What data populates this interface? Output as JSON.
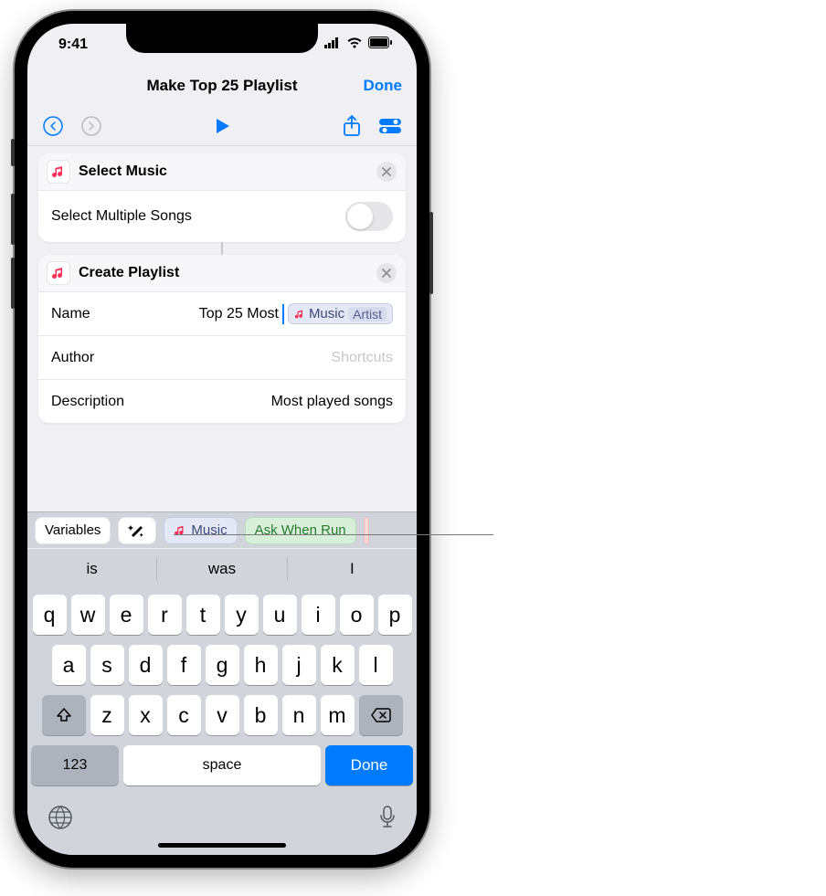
{
  "statusbar": {
    "time": "9:41"
  },
  "navbar": {
    "title": "Make Top 25 Playlist",
    "done": "Done"
  },
  "toolbar": {
    "undo_enabled": true,
    "redo_enabled": false
  },
  "action1": {
    "title": "Select Music",
    "row1_label": "Select Multiple Songs"
  },
  "action2": {
    "title": "Create Playlist",
    "name_label": "Name",
    "name_text": "Top 25 Most ",
    "name_token": "Music",
    "name_token_sub": "Artist",
    "author_label": "Author",
    "author_placeholder": "Shortcuts",
    "desc_label": "Description",
    "desc_value": "Most played songs"
  },
  "varbar": {
    "variables": "Variables",
    "music": "Music",
    "ask": "Ask When Run"
  },
  "suggestions": [
    "is",
    "was",
    "I"
  ],
  "keys_r1": [
    "q",
    "w",
    "e",
    "r",
    "t",
    "y",
    "u",
    "i",
    "o",
    "p"
  ],
  "keys_r2": [
    "a",
    "s",
    "d",
    "f",
    "g",
    "h",
    "j",
    "k",
    "l"
  ],
  "keys_r3": [
    "z",
    "x",
    "c",
    "v",
    "b",
    "n",
    "m"
  ],
  "key_num": "123",
  "key_space": "space",
  "key_done": "Done"
}
